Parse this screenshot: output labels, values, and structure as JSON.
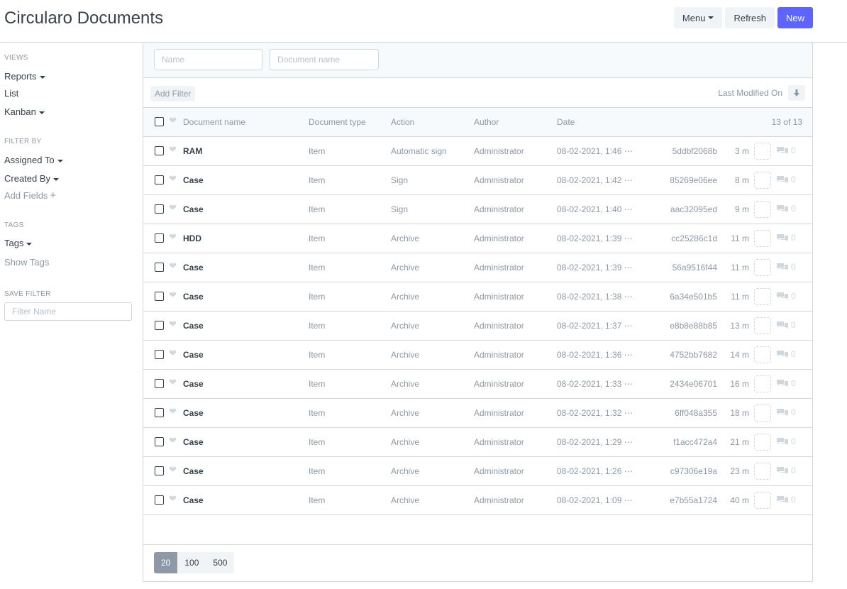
{
  "header": {
    "title": "Circularo Documents",
    "menu_label": "Menu",
    "refresh_label": "Refresh",
    "new_label": "New"
  },
  "sidebar": {
    "views_heading": "VIEWS",
    "views": [
      "Reports",
      "List",
      "Kanban"
    ],
    "filter_by_heading": "FILTER BY",
    "assigned_to": "Assigned To",
    "created_by": "Created By",
    "add_fields": "Add Fields",
    "tags_heading": "TAGS",
    "tags": "Tags",
    "show_tags": "Show Tags",
    "save_filter_heading": "SAVE FILTER",
    "filter_name_placeholder": "Filter Name"
  },
  "standard_filters": {
    "name_placeholder": "Name",
    "document_name_placeholder": "Document name"
  },
  "filter_bar": {
    "add_filter_label": "Add Filter",
    "sort_label": "Last Modified On"
  },
  "columns": {
    "document_name": "Document name",
    "document_type": "Document type",
    "action": "Action",
    "author": "Author",
    "date": "Date",
    "count": "13 of 13"
  },
  "rows": [
    {
      "name": "RAM",
      "type": "Item",
      "action": "Automatic sign",
      "author": "Administrator",
      "date": "08-02-2021, 1:46 ⋯",
      "hash": "5ddbf2068b",
      "time": "3 m",
      "comments": "0"
    },
    {
      "name": "Case",
      "type": "Item",
      "action": "Sign",
      "author": "Administrator",
      "date": "08-02-2021, 1:42 ⋯",
      "hash": "85269e06ee",
      "time": "8 m",
      "comments": "0"
    },
    {
      "name": "Case",
      "type": "Item",
      "action": "Sign",
      "author": "Administrator",
      "date": "08-02-2021, 1:40 ⋯",
      "hash": "aac32095ed",
      "time": "9 m",
      "comments": "0"
    },
    {
      "name": "HDD",
      "type": "Item",
      "action": "Archive",
      "author": "Administrator",
      "date": "08-02-2021, 1:39 ⋯",
      "hash": "cc25286c1d",
      "time": "11 m",
      "comments": "0"
    },
    {
      "name": "Case",
      "type": "Item",
      "action": "Archive",
      "author": "Administrator",
      "date": "08-02-2021, 1:39 ⋯",
      "hash": "56a9516f44",
      "time": "11 m",
      "comments": "0"
    },
    {
      "name": "Case",
      "type": "Item",
      "action": "Archive",
      "author": "Administrator",
      "date": "08-02-2021, 1:38 ⋯",
      "hash": "6a34e501b5",
      "time": "11 m",
      "comments": "0"
    },
    {
      "name": "Case",
      "type": "Item",
      "action": "Archive",
      "author": "Administrator",
      "date": "08-02-2021, 1:37 ⋯",
      "hash": "e8b8e88b85",
      "time": "13 m",
      "comments": "0"
    },
    {
      "name": "Case",
      "type": "Item",
      "action": "Archive",
      "author": "Administrator",
      "date": "08-02-2021, 1:36 ⋯",
      "hash": "4752bb7682",
      "time": "14 m",
      "comments": "0"
    },
    {
      "name": "Case",
      "type": "Item",
      "action": "Archive",
      "author": "Administrator",
      "date": "08-02-2021, 1:33 ⋯",
      "hash": "2434e06701",
      "time": "16 m",
      "comments": "0"
    },
    {
      "name": "Case",
      "type": "Item",
      "action": "Archive",
      "author": "Administrator",
      "date": "08-02-2021, 1:32 ⋯",
      "hash": "6ff048a355",
      "time": "18 m",
      "comments": "0"
    },
    {
      "name": "Case",
      "type": "Item",
      "action": "Archive",
      "author": "Administrator",
      "date": "08-02-2021, 1:29 ⋯",
      "hash": "f1acc472a4",
      "time": "21 m",
      "comments": "0"
    },
    {
      "name": "Case",
      "type": "Item",
      "action": "Archive",
      "author": "Administrator",
      "date": "08-02-2021, 1:26 ⋯",
      "hash": "c97306e19a",
      "time": "23 m",
      "comments": "0"
    },
    {
      "name": "Case",
      "type": "Item",
      "action": "Archive",
      "author": "Administrator",
      "date": "08-02-2021, 1:09 ⋯",
      "hash": "e7b55a1724",
      "time": "40 m",
      "comments": "0"
    }
  ],
  "paging": [
    "20",
    "100",
    "500"
  ],
  "colors": {
    "primary": "#5e64ff",
    "text": "#36414c",
    "muted": "#8d99a6",
    "border": "#d1d8dd"
  }
}
